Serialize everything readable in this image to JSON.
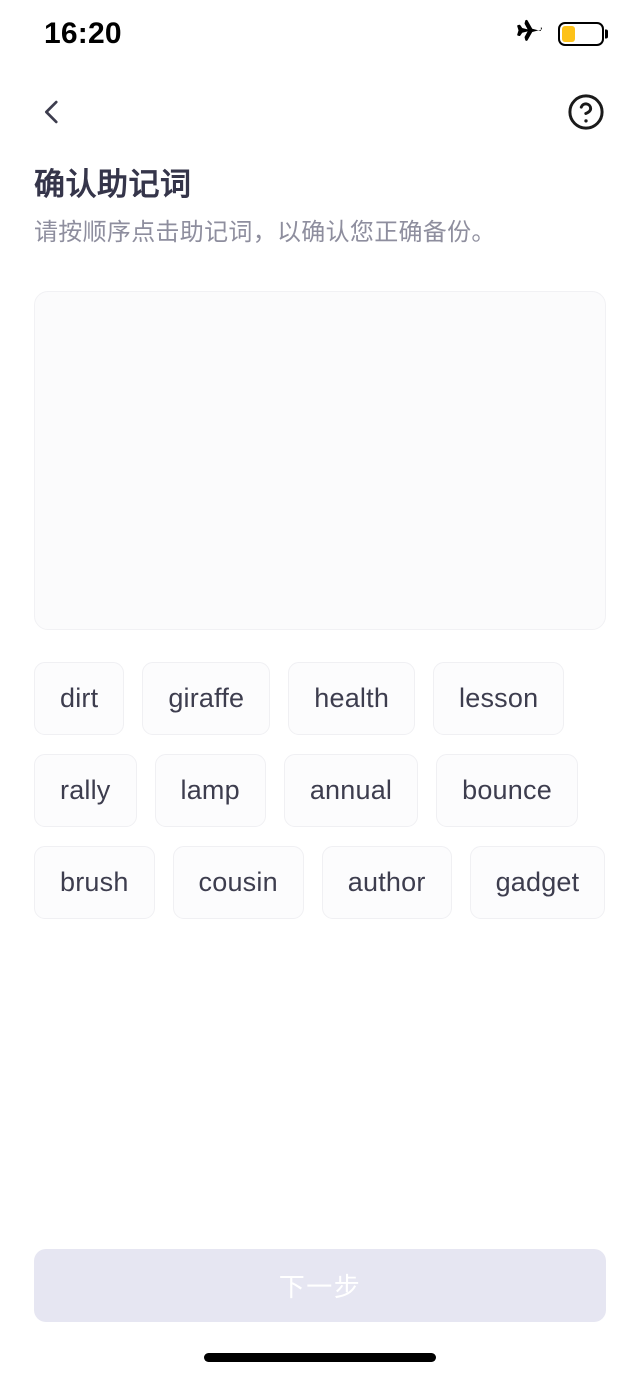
{
  "status_bar": {
    "time": "16:20",
    "airplane_icon": "airplane-icon",
    "battery_icon": "battery-icon",
    "battery_level_percent": 35,
    "battery_fill_color": "#FDC219"
  },
  "nav_bar": {
    "back_icon": "chevron-left-icon",
    "help_icon": "question-mark-circle-icon"
  },
  "header": {
    "title": "确认助记词",
    "subtitle": "请按顺序点击助记词，以确认您正确备份。"
  },
  "drop_zone": {
    "name": "selected-words-area",
    "selected_words": [],
    "background_color": "#FBFBFC",
    "border_color": "#F1F1F4"
  },
  "word_pool": {
    "words": [
      "dirt",
      "giraffe",
      "health",
      "lesson",
      "rally",
      "lamp",
      "annual",
      "bounce",
      "brush",
      "cousin",
      "author",
      "gadget"
    ],
    "chip_background_color": "#FCFCFD",
    "chip_border_color": "#F0F0F3",
    "chip_text_color": "#3D3D4E"
  },
  "footer": {
    "next_button_label": "下一步",
    "next_button_enabled": false,
    "next_button_background": "#E6E6F2",
    "next_button_text_color": "#FFFFFF"
  },
  "home_indicator": {
    "color": "#000000"
  }
}
